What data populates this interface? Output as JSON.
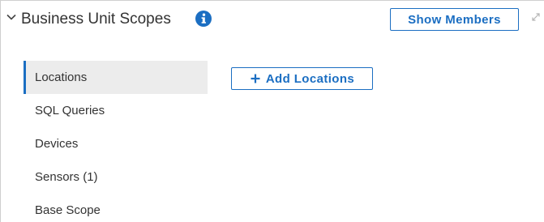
{
  "header": {
    "title": "Business Unit Scopes",
    "show_members_label": "Show Members",
    "icons": {
      "collapse": "chevron-down-icon",
      "info": "info-icon",
      "expand": "expand-icon"
    }
  },
  "sidenav": {
    "items": [
      {
        "label": "Locations",
        "active": true
      },
      {
        "label": "SQL Queries",
        "active": false
      },
      {
        "label": "Devices",
        "active": false
      },
      {
        "label": "Sensors (1)",
        "active": false
      },
      {
        "label": "Base Scope",
        "active": false
      }
    ]
  },
  "main": {
    "add_button_label": "Add Locations",
    "add_icon": "plus-icon"
  },
  "colors": {
    "accent": "#1b6ec2",
    "active_bg": "#ececec",
    "text": "#333333",
    "border": "#cfcfcf"
  }
}
